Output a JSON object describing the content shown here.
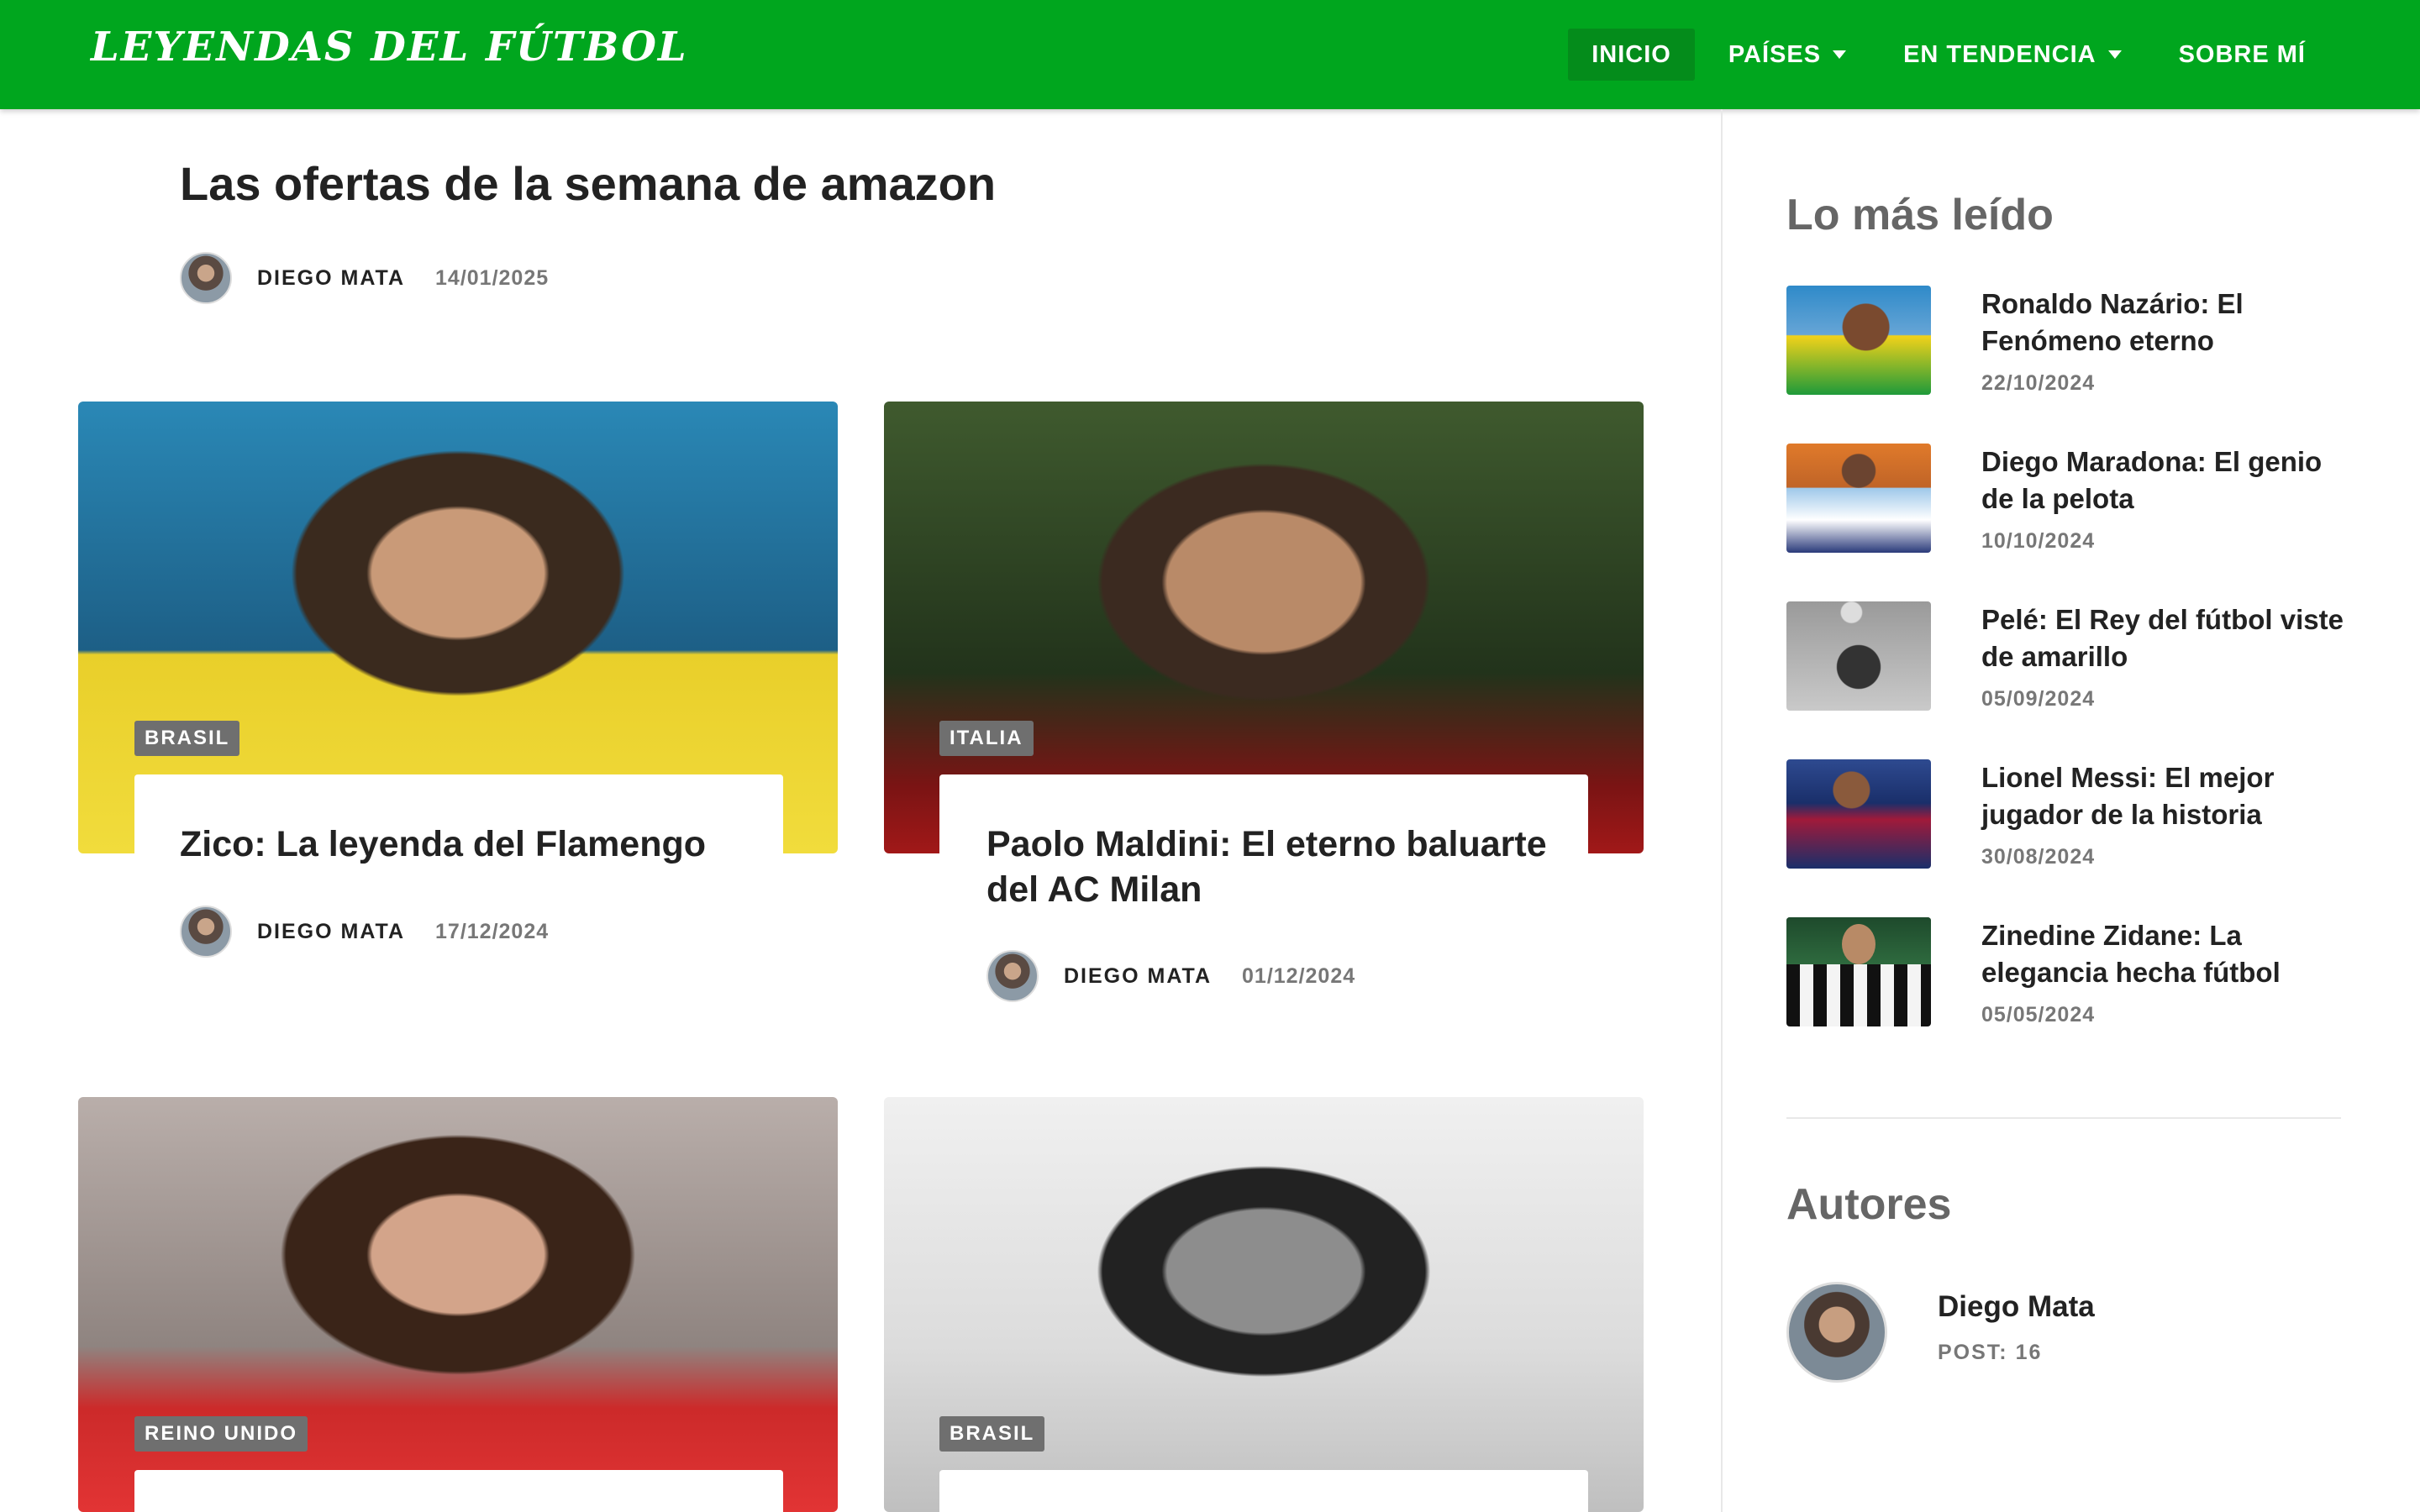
{
  "header": {
    "logo": "LEYENDAS DEL FÚTBOL",
    "nav": [
      {
        "label": "INICIO",
        "active": true,
        "dropdown": false
      },
      {
        "label": "PAÍSES",
        "active": false,
        "dropdown": true
      },
      {
        "label": "EN TENDENCIA",
        "active": false,
        "dropdown": true
      },
      {
        "label": "SOBRE MÍ",
        "active": false,
        "dropdown": false
      }
    ],
    "color": "#00a61e"
  },
  "featured": {
    "title": "Las ofertas de la semana de amazon",
    "author": "DIEGO MATA",
    "date": "14/01/2025"
  },
  "cards": [
    {
      "tag": "BRASIL",
      "title": "Zico: La leyenda del Flamengo",
      "author": "DIEGO MATA",
      "date": "17/12/2024",
      "image": "zico-photo"
    },
    {
      "tag": "ITALIA",
      "title": "Paolo Maldini: El eterno baluarte del AC Milan",
      "author": "DIEGO MATA",
      "date": "01/12/2024",
      "image": "maldini-photo"
    },
    {
      "tag": "REINO UNIDO",
      "image": "george-best-photo"
    },
    {
      "tag": "BRASIL",
      "image": "garrincha-photo"
    }
  ],
  "sidebar": {
    "most_read_heading": "Lo más leído",
    "most_read": [
      {
        "title": "Ronaldo Nazário: El Fenómeno eterno",
        "date": "22/10/2024",
        "thumb": "ronaldo-thumb"
      },
      {
        "title": "Diego Maradona: El genio de la pelota",
        "date": "10/10/2024",
        "thumb": "maradona-thumb"
      },
      {
        "title": "Pelé: El Rey del fútbol viste de amarillo",
        "date": "05/09/2024",
        "thumb": "pele-thumb"
      },
      {
        "title": "Lionel Messi: El mejor jugador de la historia",
        "date": "30/08/2024",
        "thumb": "messi-thumb"
      },
      {
        "title": "Zinedine Zidane: La elegancia hecha fútbol",
        "date": "05/05/2024",
        "thumb": "zidane-thumb"
      }
    ],
    "authors_heading": "Autores",
    "author": {
      "name": "Diego Mata",
      "posts": "POST: 16"
    }
  }
}
